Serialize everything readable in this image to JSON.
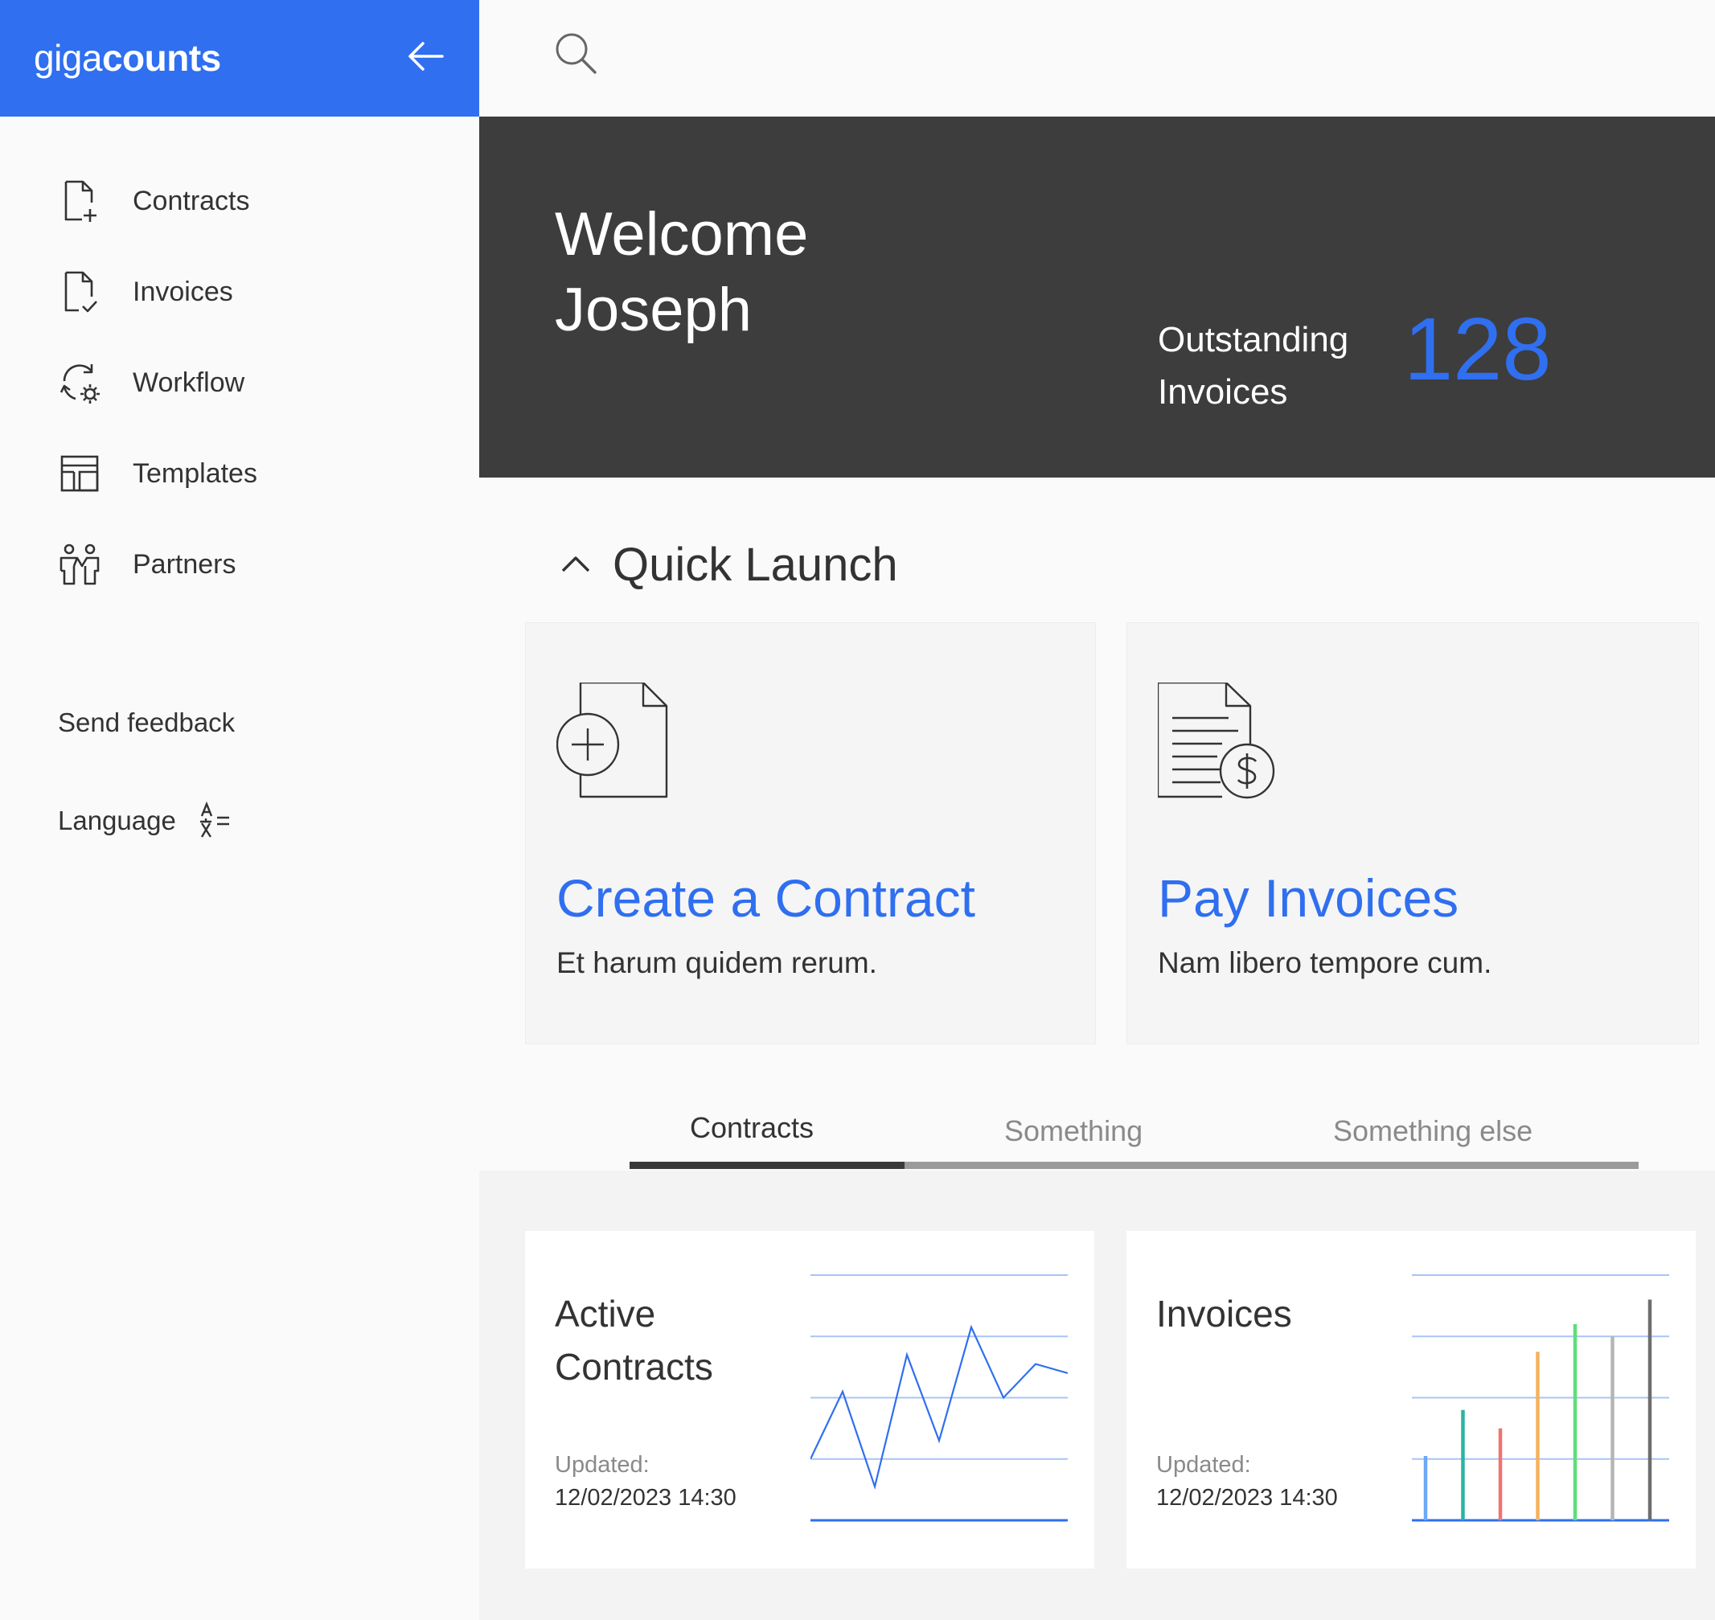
{
  "brand": {
    "light": "giga",
    "bold": "counts"
  },
  "sidebar": {
    "items": [
      {
        "label": "Contracts",
        "icon": "document-plus-icon"
      },
      {
        "label": "Invoices",
        "icon": "document-check-icon"
      },
      {
        "label": "Workflow",
        "icon": "sync-gear-icon"
      },
      {
        "label": "Templates",
        "icon": "layout-icon"
      },
      {
        "label": "Partners",
        "icon": "people-icon"
      }
    ],
    "feedback_label": "Send feedback",
    "language_label": "Language"
  },
  "hero": {
    "welcome_line1": "Welcome",
    "welcome_line2": "Joseph",
    "outstanding_line1": "Outstanding",
    "outstanding_line2": "Invoices",
    "outstanding_count": "128"
  },
  "quick_launch": {
    "title": "Quick Launch",
    "cards": [
      {
        "title": "Create a Contract",
        "description": "Et harum quidem rerum.",
        "icon": "new-document-icon"
      },
      {
        "title": "Pay Invoices",
        "description": "Nam libero tempore cum.",
        "icon": "invoice-dollar-icon"
      }
    ]
  },
  "tabs": [
    {
      "label": "Contracts",
      "active": true
    },
    {
      "label": "Something",
      "active": false
    },
    {
      "label": "Something else",
      "active": false
    }
  ],
  "stats": [
    {
      "title_line1": "Active",
      "title_line2": "Contracts",
      "updated_label": "Updated:",
      "updated_value": "12/02/2023 14:30"
    },
    {
      "title_line1": "Invoices",
      "title_line2": "",
      "updated_label": "Updated:",
      "updated_value": "12/02/2023 14:30"
    }
  ],
  "colors": {
    "accent": "#2f6ff0",
    "hero_bg": "#3d3d3d"
  },
  "chart_data": [
    {
      "type": "line",
      "ylim": [
        0,
        4
      ],
      "grid": true,
      "series": [
        {
          "values": [
            1.0,
            2.1,
            0.55,
            2.7,
            1.3,
            3.15,
            2.0,
            2.55,
            2.4
          ]
        }
      ]
    },
    {
      "type": "bar",
      "ylim": [
        0,
        4
      ],
      "grid": true,
      "values": [
        1.05,
        1.8,
        1.5,
        2.75,
        3.2,
        3.0,
        3.6
      ],
      "colors": [
        "#6ea8f7",
        "#2bb3a3",
        "#f27373",
        "#f5b25c",
        "#5fde7a",
        "#b5b5b5",
        "#6e6e6e"
      ]
    }
  ]
}
